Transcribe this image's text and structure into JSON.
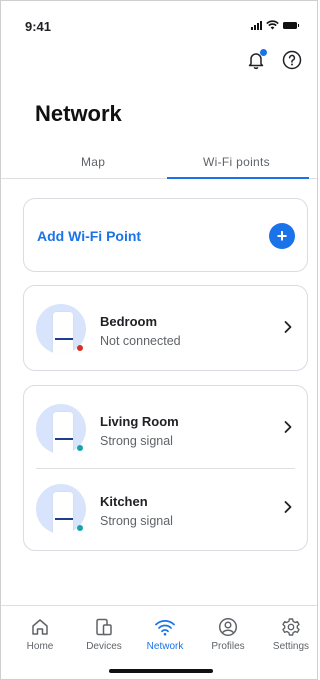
{
  "status_bar": {
    "time": "9:41"
  },
  "header": {
    "title": "Network"
  },
  "tabs": [
    {
      "label": "Map",
      "active": false
    },
    {
      "label": "Wi-Fi points",
      "active": true
    }
  ],
  "add_card": {
    "label": "Add Wi-Fi Point",
    "button": "+"
  },
  "points": [
    {
      "name": "Bedroom",
      "status": "Not connected",
      "status_color": "#d93025"
    },
    {
      "name": "Living Room",
      "status": "Strong signal",
      "status_color": "#12a4af"
    },
    {
      "name": "Kitchen",
      "status": "Strong signal",
      "status_color": "#12a4af"
    }
  ],
  "nav": [
    {
      "label": "Home",
      "icon": "home-icon",
      "active": false
    },
    {
      "label": "Devices",
      "icon": "devices-icon",
      "active": false
    },
    {
      "label": "Network",
      "icon": "wifi-icon",
      "active": true
    },
    {
      "label": "Profiles",
      "icon": "profile-icon",
      "active": false
    },
    {
      "label": "Settings",
      "icon": "gear-icon",
      "active": false
    }
  ],
  "colors": {
    "accent": "#1a73e8",
    "text": "#202124",
    "muted": "#5f6368",
    "avatar_bg": "#d7e4fb"
  }
}
